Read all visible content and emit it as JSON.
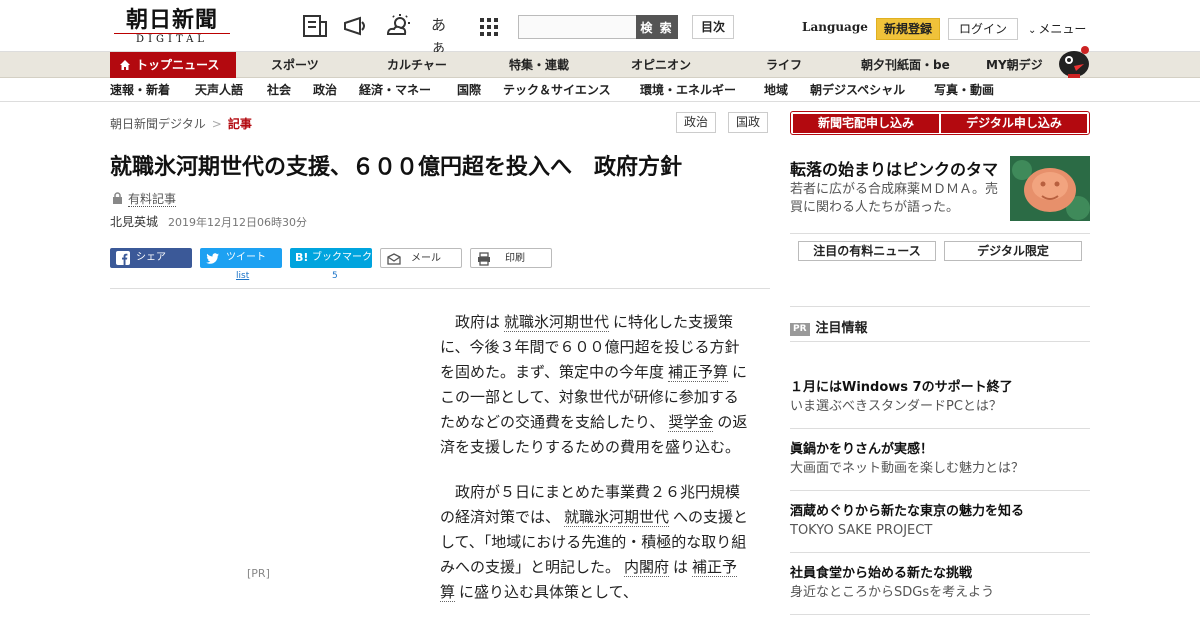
{
  "header": {
    "logo_ja": "朝日新聞",
    "logo_en": "DIGITAL",
    "kana_icon_text": "あぁ",
    "search_placeholder": "",
    "search_button": "検 索",
    "toc_button": "目次",
    "language": "Language",
    "register": "新規登録",
    "login": "ログイン",
    "menu": "メニュー"
  },
  "nav_primary": [
    "トップニュース",
    "スポーツ",
    "カルチャー",
    "特集・連載",
    "オピニオン",
    "ライフ",
    "朝夕刊紙面・be",
    "MY朝デジ"
  ],
  "nav_secondary": [
    "速報・新着",
    "天声人語",
    "社会",
    "政治",
    "経済・マネー",
    "国際",
    "テック＆サイエンス",
    "環境・エネルギー",
    "地域",
    "朝デジスペシャル",
    "写真・動画"
  ],
  "breadcrumb": {
    "root": "朝日新聞デジタル",
    "separator": ">",
    "current": "記事"
  },
  "tags": [
    "政治",
    "国政"
  ],
  "subscribe": {
    "newspaper": "新聞宅配申し込み",
    "digital": "デジタル申し込み"
  },
  "article": {
    "title": "就職氷河期世代の支援、６００億円超を投入へ　政府方針",
    "paid_label": "有料記事",
    "author": "北見英城",
    "date": "2019年12月12日06時30分",
    "share": {
      "facebook": "シェア",
      "twitter": "ツイート",
      "hatena": "ブックマーク",
      "mail": "メール",
      "print": "印刷",
      "twitter_count": "list",
      "hatena_count": "5"
    },
    "pr_label": "[PR]",
    "p1": {
      "a": "政府は",
      "k1": "就職氷河期世代",
      "b": "に特化した支援策に、今後３年間で６００億円超を投じる方針を固めた。まず、策定中の今年度",
      "k2": "補正予算",
      "c": "にこの一部として、対象世代が研修に参加するためなどの交通費を支給したり、",
      "k3": "奨学金",
      "d": "の返済を支援したりするための費用を盛り込む。"
    },
    "p2": {
      "a": "政府が５日にまとめた事業費２６兆円規模の経済対策では、",
      "k1": "就職氷河期世代",
      "b": "への支援として、「地域における先進的・積極的な取り組みへの支援」と明記した。",
      "k2": "内閣府",
      "c": "は",
      "k3": "補正予算",
      "d": "に盛り込む具体策として、"
    }
  },
  "sidebar": {
    "feature": {
      "title": "転落の始まりはピンクのタマ",
      "desc": "若者に広がる合成麻薬ＭＤＭＡ。売買に関わる人たちが語った。"
    },
    "tabs": [
      "注目の有料ニュース",
      "デジタル限定"
    ],
    "pr_badge": "PR",
    "pr_title": "注目情報",
    "ads": [
      {
        "headline": "１月にはWindows 7のサポート終了",
        "sub": "いま選ぶべきスタンダードPCとは？"
      },
      {
        "headline": "眞鍋かをりさんが実感！",
        "sub": "大画面でネット動画を楽しむ魅力とは？"
      },
      {
        "headline": "酒蔵めぐりから新たな東京の魅力を知る",
        "sub": "TOKYO SAKE PROJECT"
      },
      {
        "headline": "社員食堂から始める新たな挑戦",
        "sub": "身近なところからSDGsを考えよう"
      }
    ]
  },
  "colors": {
    "brand_red": "#b3090f",
    "register_yellow": "#f0c23a",
    "facebook": "#3b5998",
    "twitter": "#1da1f2",
    "hatena": "#00a4de"
  }
}
